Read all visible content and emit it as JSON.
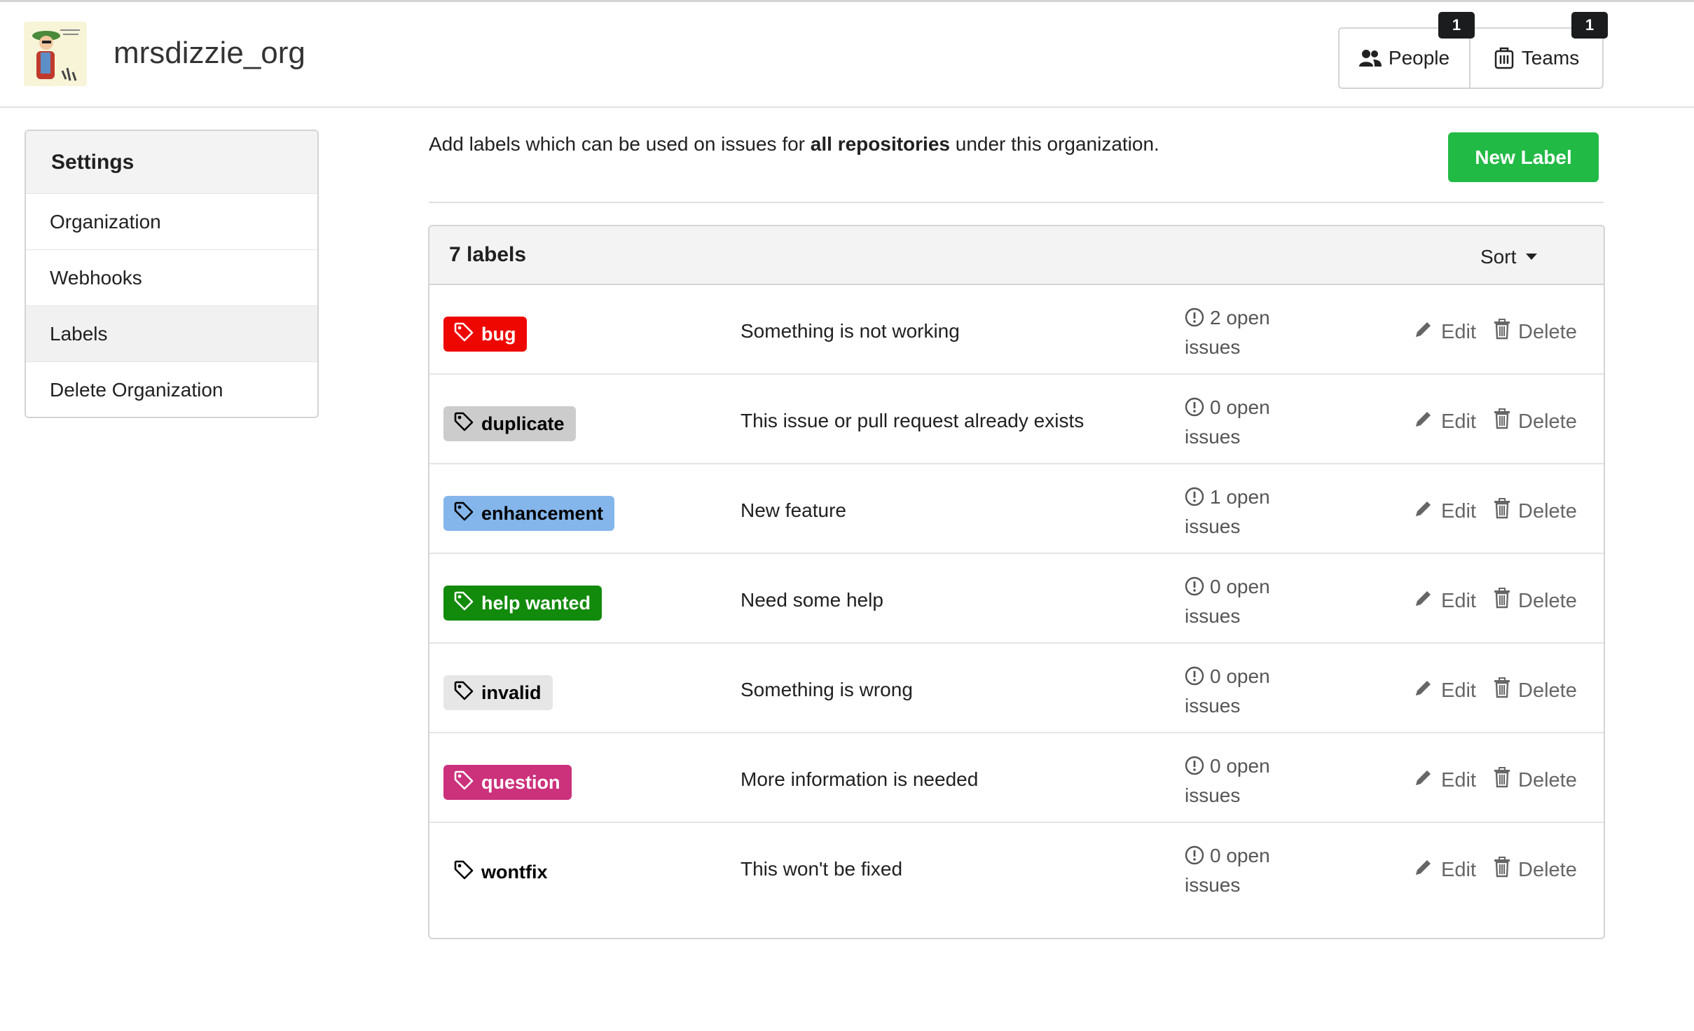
{
  "header": {
    "org_name": "mrsdizzie_org",
    "people": {
      "label": "People",
      "count": "1"
    },
    "teams": {
      "label": "Teams",
      "count": "1"
    }
  },
  "sidebar": {
    "title": "Settings",
    "items": [
      {
        "label": "Organization",
        "active": false
      },
      {
        "label": "Webhooks",
        "active": false
      },
      {
        "label": "Labels",
        "active": true
      },
      {
        "label": "Delete Organization",
        "active": false
      }
    ]
  },
  "intro": {
    "before": "Add labels which can be used on issues for ",
    "bold": "all repositories",
    "after": " under this organization."
  },
  "new_label_button": "New Label",
  "labels_panel": {
    "count_text": "7 labels",
    "sort_label": "Sort",
    "edit_label": "Edit",
    "delete_label": "Delete"
  },
  "labels": [
    {
      "name": "bug",
      "color": "#ee0701",
      "text_color": "#ffffff",
      "description": "Something is not working",
      "issues_line1": "2 open",
      "issues_line2": "issues"
    },
    {
      "name": "duplicate",
      "color": "#cccccc",
      "text_color": "#000000",
      "description": "This issue or pull request already exists",
      "issues_line1": "0 open",
      "issues_line2": "issues"
    },
    {
      "name": "enhancement",
      "color": "#84b6eb",
      "text_color": "#000000",
      "description": "New feature",
      "issues_line1": "1 open",
      "issues_line2": "issues"
    },
    {
      "name": "help wanted",
      "color": "#128a0c",
      "text_color": "#ffffff",
      "description": "Need some help",
      "issues_line1": "0 open",
      "issues_line2": "issues"
    },
    {
      "name": "invalid",
      "color": "#e6e6e6",
      "text_color": "#000000",
      "description": "Something is wrong",
      "issues_line1": "0 open",
      "issues_line2": "issues"
    },
    {
      "name": "question",
      "color": "#cc317c",
      "text_color": "#ffffff",
      "description": "More information is needed",
      "issues_line1": "0 open",
      "issues_line2": "issues"
    },
    {
      "name": "wontfix",
      "color": "#ffffff",
      "text_color": "#000000",
      "description": "This won't be fixed",
      "issues_line1": "0 open",
      "issues_line2": "issues"
    }
  ]
}
